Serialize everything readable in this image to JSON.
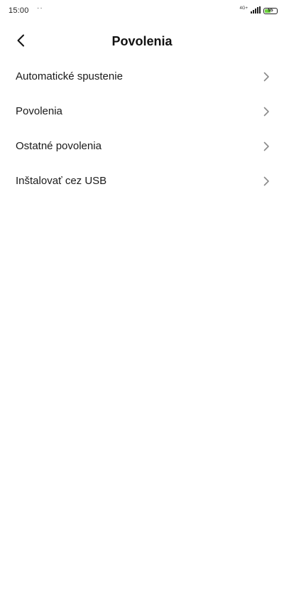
{
  "status_bar": {
    "time": "15:00",
    "notification_dots": "··",
    "network": "4G+",
    "battery_level": "55",
    "battery_fraction": 0.55,
    "battery_color": "#6dd13d"
  },
  "header": {
    "title": "Povolenia",
    "back_icon": "chevron-left-icon"
  },
  "menu": {
    "items": [
      {
        "label": "Automatické spustenie",
        "icon": "chevron-right-icon"
      },
      {
        "label": "Povolenia",
        "icon": "chevron-right-icon"
      },
      {
        "label": "Ostatné povolenia",
        "icon": "chevron-right-icon"
      },
      {
        "label": "Inštalovať cez USB",
        "icon": "chevron-right-icon"
      }
    ]
  }
}
